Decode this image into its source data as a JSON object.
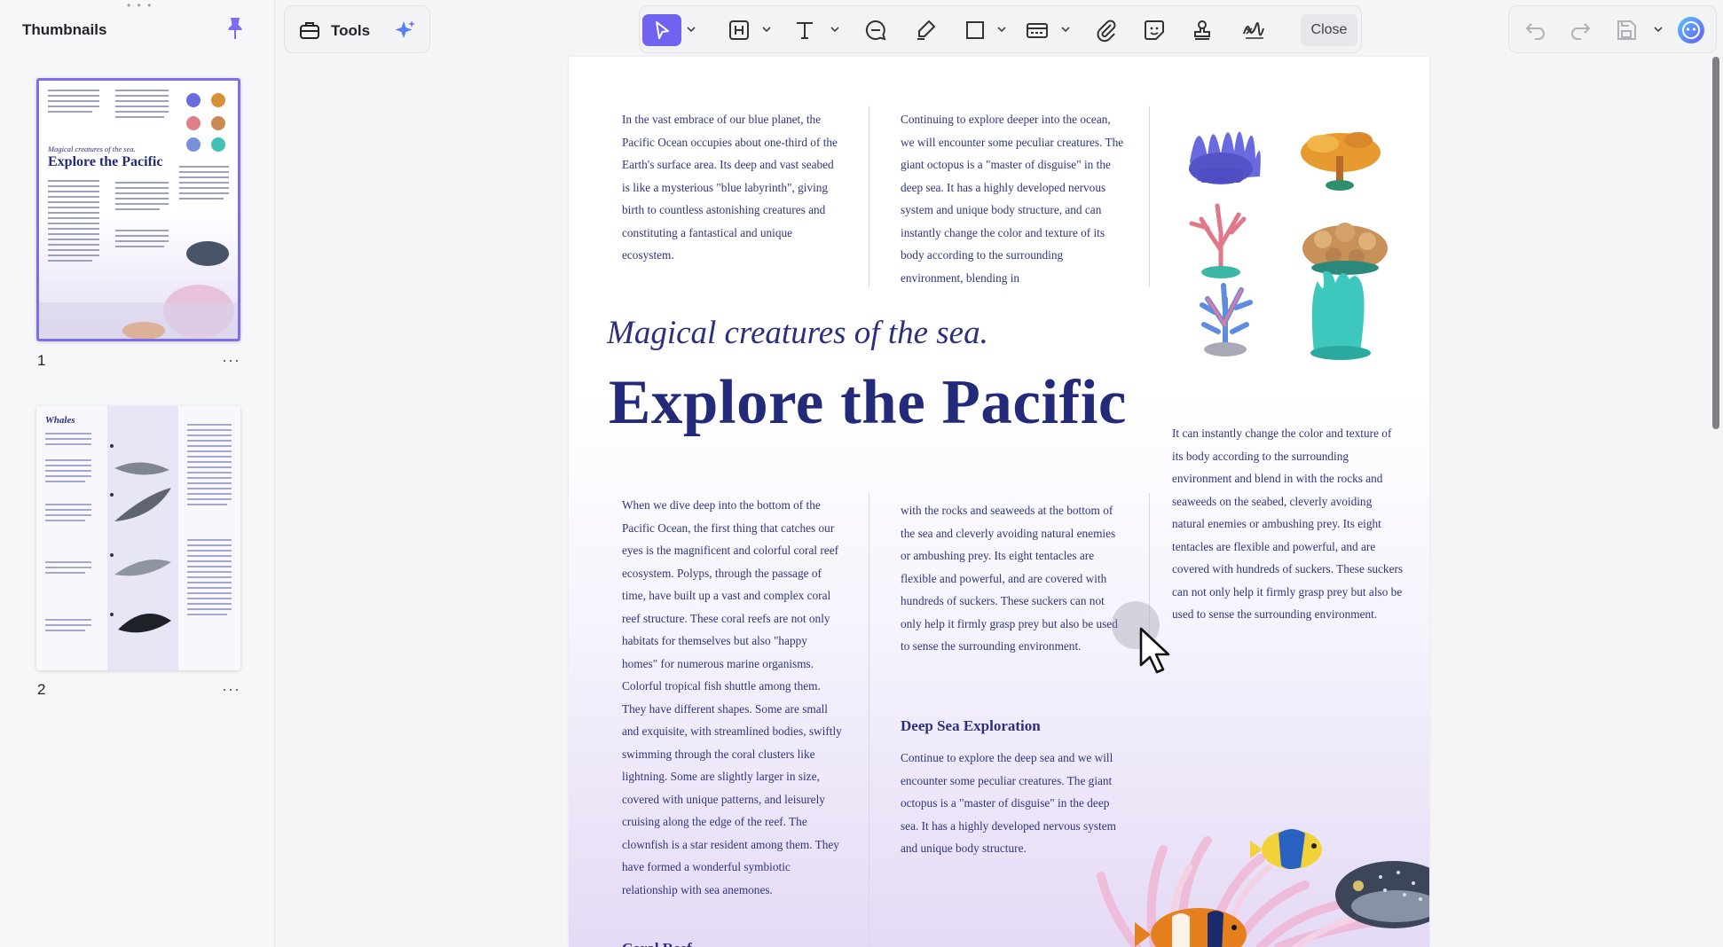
{
  "sidebar": {
    "title": "Thumbnails",
    "pages": [
      {
        "number": "1",
        "thumb_subtitle": "Magical creatures of the sea.",
        "thumb_title": "Explore the Pacific",
        "more": "···"
      },
      {
        "number": "2",
        "thumb_title": "Whales",
        "more": "···"
      }
    ]
  },
  "toolbar": {
    "tools_label": "Tools",
    "close_label": "Close",
    "icons": [
      "toolbox-icon",
      "ai-sparkle-icon",
      "select-arrow-icon",
      "header-icon",
      "text-icon",
      "comment-icon",
      "highlight-icon",
      "rectangle-icon",
      "form-field-icon",
      "attachment-icon",
      "sticker-icon",
      "stamp-icon",
      "signature-icon",
      "undo-icon",
      "redo-icon",
      "save-icon",
      "ai-assistant-icon"
    ]
  },
  "document": {
    "col1_top": "In the vast embrace of our blue planet, the Pacific Ocean occupies about one-third of the Earth's surface area. Its deep and vast seabed is like a mysterious \"blue labyrinth\", giving birth to countless astonishing creatures and constituting a fantastical and unique ecosystem.",
    "col2_top": "Continuing to explore deeper into the ocean, we will encounter some peculiar creatures. The giant octopus is a \"master of disguise\" in the deep sea. It has a highly developed nervous system and unique body structure, and can instantly change the color and texture of its body according to the surrounding environment, blending in",
    "subtitle": "Magical creatures of the sea.",
    "title": "Explore the Pacific",
    "col3_mid": "It can instantly change the color and texture of its body according to the surrounding environment and blend in with the rocks and seaweeds on the seabed, cleverly avoiding natural enemies or ambushing prey. Its eight tentacles are flexible and powerful, and are covered with hundreds of suckers. These suckers can not only help it firmly grasp prey but also be used to sense the surrounding environment.",
    "col1_bottom": "When we dive deep into the bottom of the Pacific Ocean, the first thing that catches our eyes is the magnificent and colorful coral reef ecosystem. Polyps, through the passage of time, have built up a vast and complex coral reef structure. These coral reefs are not only habitats for themselves but also \"happy homes\" for numerous marine organisms. Colorful tropical fish shuttle among them. They have different shapes. Some are small and exquisite, with streamlined bodies, swiftly swimming through the coral clusters like lightning. Some are slightly larger in size, covered with unique patterns, and leisurely cruising along the edge of the reef. The clownfish is a star resident among them. They have formed a wonderful symbiotic relationship with sea anemones.",
    "col2_bottom": "with the rocks and seaweeds at the bottom of the sea and cleverly avoiding natural enemies or ambushing prey. Its eight tentacles are flexible and powerful, and are covered with hundreds of suckers. These suckers can not only help it firmly grasp prey but also be used to sense the surrounding environment.",
    "deep_sea_heading": "Deep Sea Exploration",
    "deep_sea_text": "Continue to explore the deep sea and we will encounter some peculiar creatures. The giant octopus is a \"master of disguise\" in the deep sea. It has a highly developed nervous system and unique body structure.",
    "coral_reef_heading": "Coral Reef"
  },
  "colors": {
    "accent": "#6f63f0",
    "text_navy": "#2e3480"
  }
}
